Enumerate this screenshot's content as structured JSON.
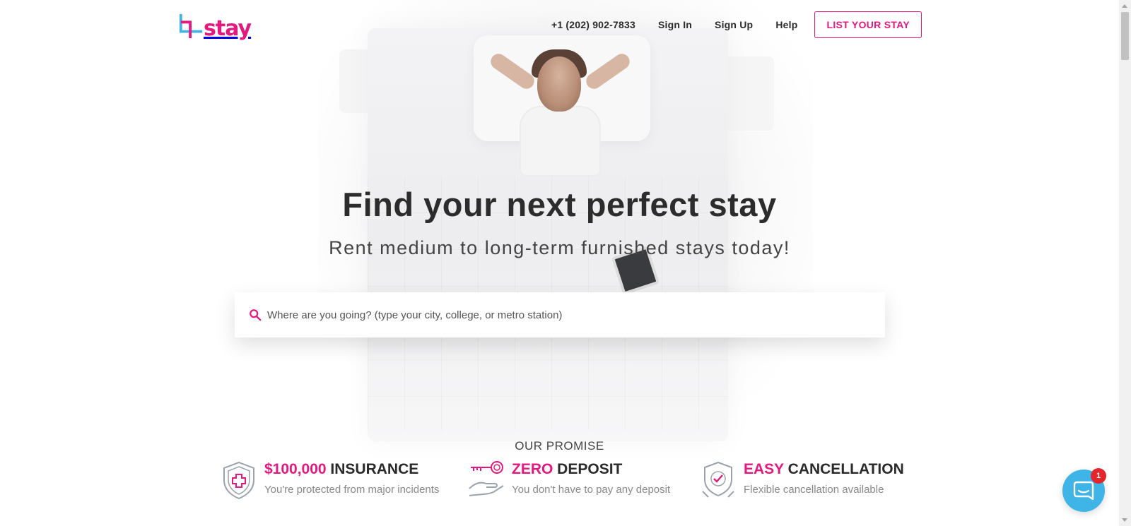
{
  "brand": {
    "name": "stay",
    "accent_color": "#e5187f",
    "secondary_color": "#3fb4e6"
  },
  "nav": {
    "phone": "+1 (202) 902-7833",
    "sign_in": "Sign In",
    "sign_up": "Sign Up",
    "help": "Help",
    "list_your_stay": "LIST YOUR STAY"
  },
  "hero": {
    "headline": "Find your next perfect stay",
    "subheadline": "Rent medium to long-term furnished stays today!"
  },
  "search": {
    "placeholder": "Where are you going? (type your city, college, or metro station)",
    "icon": "search-icon"
  },
  "promise": {
    "title": "OUR PROMISE",
    "items": [
      {
        "accent": "$100,000",
        "label": " INSURANCE",
        "description": "You're protected from major incidents",
        "icon": "shield-cross-icon"
      },
      {
        "accent": "ZERO",
        "label": " DEPOSIT",
        "description": "You don't have to pay any deposit",
        "icon": "key-hand-icon"
      },
      {
        "accent": "EASY",
        "label": " CANCELLATION",
        "description": "Flexible cancellation available",
        "icon": "badge-check-icon"
      }
    ]
  },
  "chat": {
    "badge_count": "1",
    "icon": "chat-icon"
  }
}
